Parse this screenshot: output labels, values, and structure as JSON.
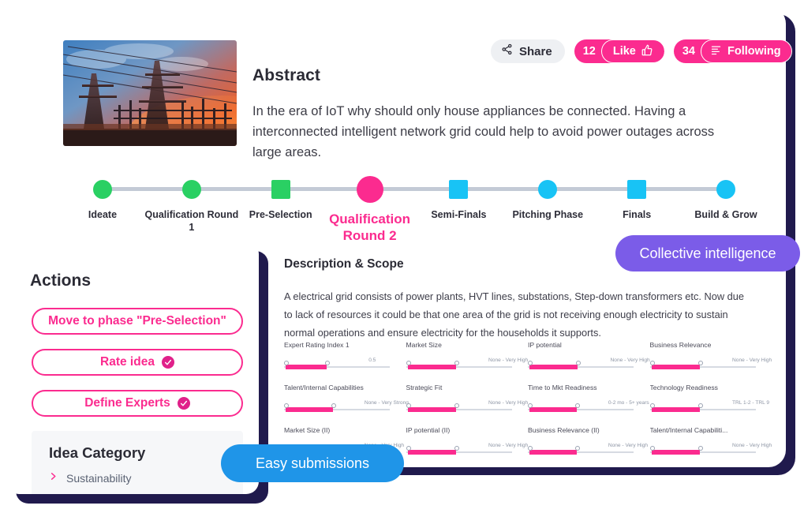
{
  "header": {
    "hero_image_alt": "power-transmission-towers-at-sunset",
    "abstract_title": "Abstract",
    "abstract_body": "In the era of IoT why should only house appliances be connected. Having a interconnected intelligent network grid could help to avoid power outages across large areas."
  },
  "social": {
    "share_label": "Share",
    "like_count": "12",
    "like_label": "Like",
    "following_count": "34",
    "following_label": "Following"
  },
  "timeline": {
    "steps": [
      {
        "label": "Ideate",
        "shape": "circle",
        "color": "#2ad063",
        "state": "done"
      },
      {
        "label": "Qualification Round 1",
        "shape": "circle",
        "color": "#2ad063",
        "state": "done"
      },
      {
        "label": "Pre-Selection",
        "shape": "square",
        "color": "#2ad063",
        "state": "done"
      },
      {
        "label": "Qualification Round 2",
        "shape": "circle",
        "color": "#fb2b8f",
        "state": "current"
      },
      {
        "label": "Semi-Finals",
        "shape": "square",
        "color": "#18c3f5",
        "state": "upcoming"
      },
      {
        "label": "Pitching Phase",
        "shape": "circle",
        "color": "#18c3f5",
        "state": "upcoming"
      },
      {
        "label": "Finals",
        "shape": "square",
        "color": "#18c3f5",
        "state": "upcoming"
      },
      {
        "label": "Build & Grow",
        "shape": "circle",
        "color": "#18c3f5",
        "state": "upcoming"
      }
    ]
  },
  "description": {
    "title": "Description & Scope",
    "body": "A electrical grid consists of power plants, HVT lines, substations, Step-down transformers etc. Now due to lack of resources it could be that one area of the grid is not receiving enough electricity to sustain normal operations and ensure electricity for the households it supports."
  },
  "criteria": [
    {
      "name": "Expert Rating Index 1",
      "scale": "0.5",
      "fill_pct": 62,
      "scale_left_pct": 80
    },
    {
      "name": "Market Size",
      "scale": "None - Very High",
      "fill_pct": 74,
      "scale_left_pct": 78
    },
    {
      "name": "IP potential",
      "scale": "None - Very High",
      "fill_pct": 74,
      "scale_left_pct": 78
    },
    {
      "name": "Business Relevance",
      "scale": "None - Very High",
      "fill_pct": 74,
      "scale_left_pct": 78
    },
    {
      "name": "Talent/Internal Capabilities",
      "scale": "None - Very Strong",
      "fill_pct": 72,
      "scale_left_pct": 76
    },
    {
      "name": "Strategic Fit",
      "scale": "None - Very High",
      "fill_pct": 74,
      "scale_left_pct": 78
    },
    {
      "name": "Time to Mkt Readiness",
      "scale": "0-2 mo - 5+ years",
      "fill_pct": 72,
      "scale_left_pct": 76
    },
    {
      "name": "Technology Readiness",
      "scale": "TRL 1-2 - TRL 9",
      "fill_pct": 74,
      "scale_left_pct": 78
    },
    {
      "name": "Market Size (II)",
      "scale": "None - Very High",
      "fill_pct": 72,
      "scale_left_pct": 76
    },
    {
      "name": "IP potential (II)",
      "scale": "None - Very High",
      "fill_pct": 74,
      "scale_left_pct": 78
    },
    {
      "name": "Business Relevance (II)",
      "scale": "None - Very High",
      "fill_pct": 72,
      "scale_left_pct": 76
    },
    {
      "name": "Talent/Internal Capabiliti...",
      "scale": "None - Very High",
      "fill_pct": 74,
      "scale_left_pct": 78
    }
  ],
  "actions": {
    "title": "Actions",
    "buttons": [
      {
        "label": "Move to phase \"Pre-Selection\"",
        "checked": false
      },
      {
        "label": "Rate idea",
        "checked": true
      },
      {
        "label": "Define Experts",
        "checked": true
      }
    ],
    "category": {
      "title": "Idea Category",
      "value": "Sustainability"
    }
  },
  "features": {
    "collective_intelligence": "Collective intelligence",
    "easy_submissions": "Easy submissions"
  },
  "colors": {
    "pink": "#fb2b8f",
    "green": "#2ad063",
    "blue": "#18c3f5",
    "purple": "#7b5ce8",
    "feature_blue": "#1f95e8",
    "navy_shadow": "#201a4d"
  }
}
